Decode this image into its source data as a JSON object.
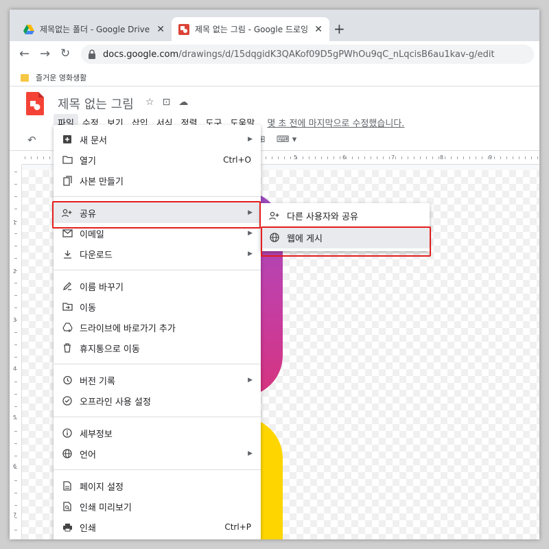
{
  "browser": {
    "tabs": [
      {
        "title": "제목없는 폴더 - Google Drive",
        "active": false
      },
      {
        "title": "제목 없는 그림 - Google 드로잉",
        "active": true
      }
    ],
    "new_tab": "+",
    "close": "✕",
    "url_host": "docs.google.com",
    "url_path": "/drawings/d/15dqgidK3QAKof09D5gPWhOu9qC_nLqcisB6au1kav-g/edit",
    "bookmark": "즐거운 영화생활"
  },
  "app": {
    "doc_title": "제목 없는 그림",
    "menu": [
      "파일",
      "수정",
      "보기",
      "삽입",
      "서식",
      "정렬",
      "도구",
      "도움말"
    ],
    "last_edit": "몇 초 전에 마지막으로 수정했습니다.",
    "ruler_numbers": [
      "5",
      "6",
      "7",
      "8",
      "9"
    ],
    "left_ruler_numbers": [
      "1",
      "2",
      "3",
      "4",
      "5",
      "6",
      "7"
    ],
    "colors": {
      "accent": "#1a73e8",
      "highlight": "#e31d1d",
      "drawings": "#f44336"
    }
  },
  "file_menu": {
    "groups": [
      [
        {
          "label": "새 문서",
          "icon": "new-doc-icon",
          "arrow": true
        },
        {
          "label": "열기",
          "icon": "folder-icon",
          "shortcut": "Ctrl+O"
        },
        {
          "label": "사본 만들기",
          "icon": "copy-icon"
        }
      ],
      [
        {
          "label": "공유",
          "icon": "share-person-icon",
          "arrow": true,
          "highlighted": true
        },
        {
          "label": "이메일",
          "icon": "email-icon",
          "arrow": true
        },
        {
          "label": "다운로드",
          "icon": "download-icon",
          "arrow": true
        }
      ],
      [
        {
          "label": "이름 바꾸기",
          "icon": "rename-icon"
        },
        {
          "label": "이동",
          "icon": "move-folder-icon"
        },
        {
          "label": "드라이브에 바로가기 추가",
          "icon": "drive-shortcut-icon"
        },
        {
          "label": "휴지통으로 이동",
          "icon": "trash-icon"
        }
      ],
      [
        {
          "label": "버전 기록",
          "icon": "history-icon",
          "arrow": true
        },
        {
          "label": "오프라인 사용 설정",
          "icon": "offline-icon"
        }
      ],
      [
        {
          "label": "세부정보",
          "icon": "info-icon"
        },
        {
          "label": "언어",
          "icon": "globe-icon",
          "arrow": true
        }
      ],
      [
        {
          "label": "페이지 설정",
          "icon": "page-setup-icon"
        },
        {
          "label": "인쇄 미리보기",
          "icon": "print-preview-icon"
        },
        {
          "label": "인쇄",
          "icon": "print-icon",
          "shortcut": "Ctrl+P"
        }
      ]
    ]
  },
  "share_submenu": [
    {
      "label": "다른 사용자와 공유",
      "icon": "share-person-icon"
    },
    {
      "label": "웹에 게시",
      "icon": "globe-icon",
      "highlighted": true
    }
  ]
}
